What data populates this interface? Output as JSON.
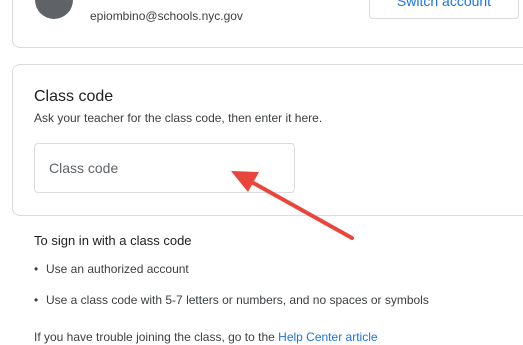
{
  "account": {
    "email": "epiombino@schools.nyc.gov",
    "switch_label": "Switch account"
  },
  "class_code": {
    "title": "Class code",
    "subtitle": "Ask your teacher for the class code, then enter it here.",
    "input_placeholder": "Class code",
    "input_value": ""
  },
  "info": {
    "heading": "To sign in with a class code",
    "bullet_glyph": "•",
    "items": [
      "Use an authorized account",
      "Use a class code with 5-7 letters or numbers, and no spaces or symbols"
    ],
    "help_text": "If you have trouble joining the class, go to the ",
    "help_link_label": "Help Center article"
  },
  "colors": {
    "accent": "#1a73e8",
    "border": "#dadce0",
    "annotation_arrow": "#e8453c"
  },
  "icons": {
    "avatar": "avatar-icon",
    "arrow": "red-arrow-annotation"
  }
}
